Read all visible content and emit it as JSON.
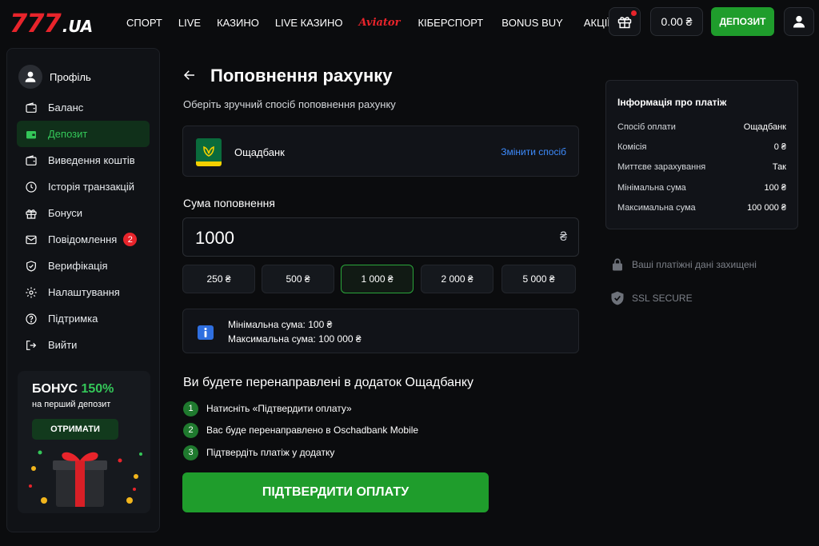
{
  "brand": {
    "logo_number": "777",
    "logo_domain": ".UA"
  },
  "nav": {
    "items": [
      {
        "label": "СПОРТ"
      },
      {
        "label": "LIVE"
      },
      {
        "label": "КАЗИНО"
      },
      {
        "label": "LIVE КАЗИНО"
      },
      {
        "label": "Aviator"
      },
      {
        "label": "КІБЕРСПОРТ"
      },
      {
        "label": "BONUS BUY"
      },
      {
        "label": "АКЦІЇ"
      }
    ],
    "balance": "0.00 ₴",
    "deposit_label": "ДЕПОЗИТ"
  },
  "sidebar": {
    "profile_label": "Профіль",
    "items": [
      {
        "label": "Баланс",
        "icon": "wallet-icon"
      },
      {
        "label": "Депозит",
        "icon": "wallet-icon",
        "active": true
      },
      {
        "label": "Виведення коштів",
        "icon": "wallet-icon"
      },
      {
        "label": "Історія транзакцій",
        "icon": "history-icon"
      },
      {
        "label": "Бонуси",
        "icon": "gift-icon"
      },
      {
        "label": "Повідомлення",
        "icon": "mail-icon",
        "badge": "2"
      },
      {
        "label": "Верифікація",
        "icon": "shield-check-icon"
      },
      {
        "label": "Налаштування",
        "icon": "gear-icon"
      },
      {
        "label": "Підтримка",
        "icon": "help-icon"
      },
      {
        "label": "Вийти",
        "icon": "logout-icon"
      }
    ],
    "promo": {
      "title_prefix": "БОНУС",
      "title_percent": "150%",
      "subtitle": "на перший депозит",
      "button": "ОТРИМАТИ"
    }
  },
  "main": {
    "title": "Поповнення рахунку",
    "subtitle": "Оберіть зручний спосіб поповнення рахунку",
    "bank": {
      "name": "Ощадбанк",
      "change_label": "Змінити спосіб"
    },
    "amount_label": "Сума поповнення",
    "amount_value": "1000",
    "currency": "₴",
    "quick_amounts": [
      {
        "label": "250 ₴"
      },
      {
        "label": "500 ₴"
      },
      {
        "label": "1 000 ₴",
        "active": true
      },
      {
        "label": "2 000 ₴"
      },
      {
        "label": "5 000 ₴"
      }
    ],
    "limits": {
      "min": "Мінімальна сума: 100 ₴",
      "max": "Максимальна сума: 100 000 ₴"
    },
    "redirect_title": "Ви будете перенаправлені в додаток Ощадбанку",
    "steps": [
      {
        "num": "1",
        "text": "Натисніть «Підтвердити оплату»"
      },
      {
        "num": "2",
        "text": "Вас буде перенаправлено в Oschadbank Mobile"
      },
      {
        "num": "3",
        "text": "Підтвердіть платіж у додатку"
      }
    ],
    "confirm_label": "ПІДТВЕРДИТИ ОПЛАТУ"
  },
  "payment_info": {
    "title": "Інформація про платіж",
    "rows": [
      {
        "label": "Спосіб оплати",
        "value": "Ощадбанк"
      },
      {
        "label": "Комісія",
        "value": "0 ₴"
      },
      {
        "label": "Миттєве зарахування",
        "value": "Так"
      },
      {
        "label": "Мінімальна сума",
        "value": "100 ₴"
      },
      {
        "label": "Максимальна сума",
        "value": "100 000 ₴"
      }
    ],
    "secure_data": "Ваші платіжні дані захищені",
    "ssl": "SSL SECURE"
  },
  "colors": {
    "accent_green": "#1f9d2c",
    "brand_red": "#e8242b",
    "link_blue": "#3d8bfd"
  }
}
